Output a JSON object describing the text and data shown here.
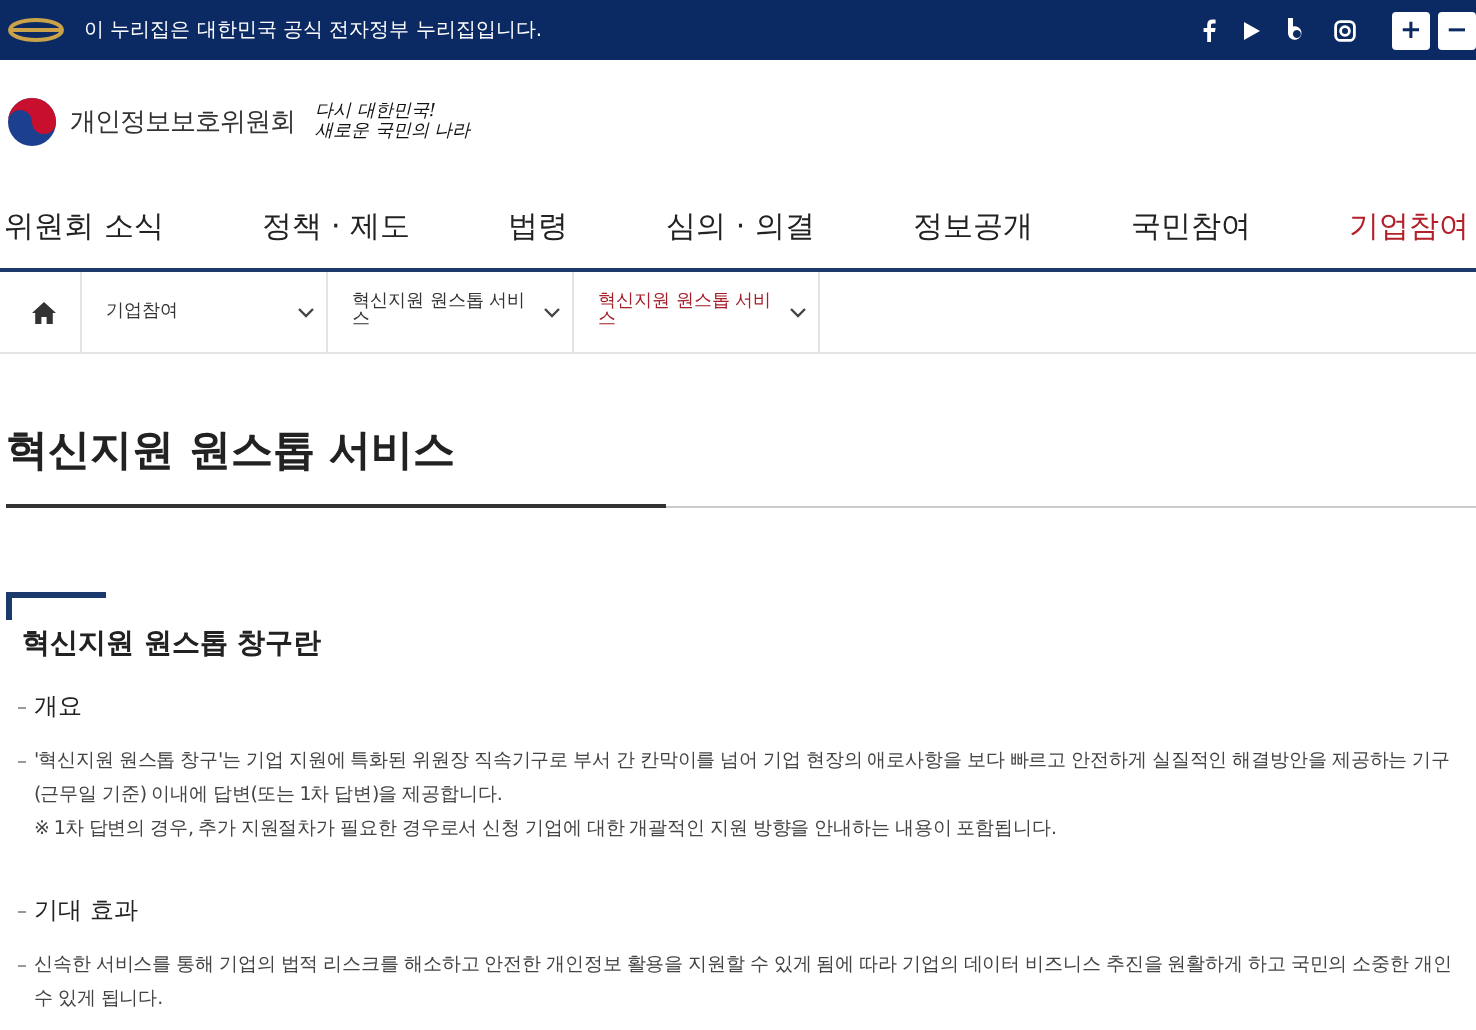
{
  "top_bar": {
    "notice": "이 누리집은 대한민국 공식 전자정부 누리집입니다.",
    "zoom_buttons": [
      "+",
      "−"
    ]
  },
  "header": {
    "org_name": "개인정보보호위원회",
    "slogan_lines": [
      "다시 대한민국!",
      "새로운 국민의 나라"
    ]
  },
  "nav": [
    {
      "label": "위원회 소식",
      "selected": false
    },
    {
      "label": "정책 · 제도",
      "selected": false
    },
    {
      "label": "법령",
      "selected": false
    },
    {
      "label": "심의 · 의결",
      "selected": false
    },
    {
      "label": "정보공개",
      "selected": false
    },
    {
      "label": "국민참여",
      "selected": false
    },
    {
      "label": "기업참여",
      "selected": true
    }
  ],
  "breadcrumb": [
    {
      "label": "기업참여",
      "selected": false
    },
    {
      "label": "혁신지원 원스톱 서비스",
      "selected": false
    },
    {
      "label": "혁신지원 원스톱 서비스",
      "selected": true
    }
  ],
  "page_title": "혁신지원 원스톱 서비스",
  "section": {
    "title": "혁신지원 원스톱 창구란",
    "blocks": [
      {
        "kind": "heading",
        "text": "개요"
      },
      {
        "kind": "paragraph",
        "lines": [
          "'혁신지원 원스톱 창구'는 기업 지원에 특화된 위원장 직속기구로 부서 간 칸막이를 넘어 기업 현장의 애로사항을 보다 빠르고 안전하게 실질적인 해결방안을 제공하는 기구",
          "(근무일 기준) 이내에 답변(또는 1차 답변)을 제공합니다.",
          "※ 1차 답변의 경우, 추가 지원절차가 필요한 경우로서 신청 기업에 대한 개괄적인 지원 방향을 안내하는 내용이 포함됩니다."
        ]
      },
      {
        "kind": "heading",
        "text": "기대 효과"
      },
      {
        "kind": "paragraph",
        "lines": [
          "신속한 서비스를 통해 기업의 법적 리스크를 해소하고 안전한 개인정보 활용을 지원할 수 있게 됨에 따라 기업의 데이터 비즈니스 추진을 원활하게 하고 국민의 소중한 개인",
          "수 있게 됩니다."
        ]
      }
    ]
  }
}
